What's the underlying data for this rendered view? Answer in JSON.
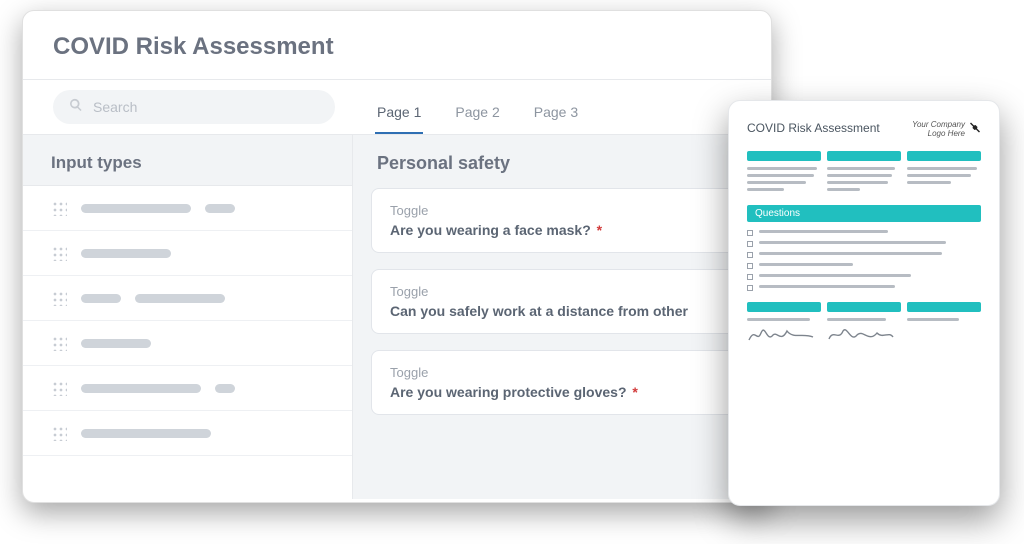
{
  "builder": {
    "title": "COVID Risk Assessment",
    "search_placeholder": "Search",
    "tabs": [
      {
        "label": "Page 1"
      },
      {
        "label": "Page 2"
      },
      {
        "label": "Page 3"
      }
    ],
    "sidebar_heading": "Input types",
    "section_heading": "Personal safety",
    "cards": [
      {
        "type": "Toggle",
        "question": "Are you wearing a face mask?",
        "required": true
      },
      {
        "type": "Toggle",
        "question": "Can you safely work at a distance from other",
        "required": false
      },
      {
        "type": "Toggle",
        "question": "Are you wearing protective gloves?",
        "required": true
      }
    ]
  },
  "preview": {
    "title": "COVID Risk Assessment",
    "logo_line1": "Your Company",
    "logo_line2": "Logo Here",
    "questions_label": "Questions"
  }
}
